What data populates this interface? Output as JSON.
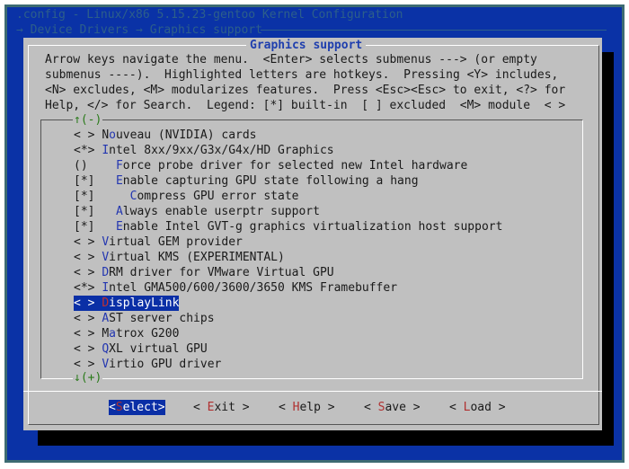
{
  "header": {
    "title": ".config - Linux/x86 5.15.23-gentoo Kernel Configuration",
    "breadcrumb": "→ Device Drivers → Graphics support"
  },
  "dialog": {
    "title": "Graphics support",
    "help_lines": [
      "Arrow keys navigate the menu.  <Enter> selects submenus ---> (or empty",
      "submenus ----).  Highlighted letters are hotkeys.  Pressing <Y> includes,",
      "<N> excludes, <M> modularizes features.  Press <Esc><Esc> to exit, <?> for",
      "Help, </> for Search.  Legend: [*] built-in  [ ] excluded  <M> module  < >"
    ],
    "scroll_up": "↑(-)",
    "scroll_down": "↓(+)",
    "items": [
      {
        "prefix": "< > ",
        "pre": "N",
        "key": "o",
        "post": "uveau (NVIDIA) cards"
      },
      {
        "prefix": "<*> ",
        "pre": "",
        "key": "I",
        "post": "ntel 8xx/9xx/G3x/G4x/HD Graphics"
      },
      {
        "prefix": "()    ",
        "pre": "",
        "key": "F",
        "post": "orce probe driver for selected new Intel hardware"
      },
      {
        "prefix": "[*]   ",
        "pre": "",
        "key": "E",
        "post": "nable capturing GPU state following a hang"
      },
      {
        "prefix": "[*]     ",
        "pre": "",
        "key": "C",
        "post": "ompress GPU error state"
      },
      {
        "prefix": "[*]   ",
        "pre": "",
        "key": "A",
        "post": "lways enable userptr support"
      },
      {
        "prefix": "[*]   ",
        "pre": "",
        "key": "E",
        "post": "nable Intel GVT-g graphics virtualization host support"
      },
      {
        "prefix": "< > ",
        "pre": "",
        "key": "V",
        "post": "irtual GEM provider"
      },
      {
        "prefix": "< > ",
        "pre": "",
        "key": "V",
        "post": "irtual KMS (EXPERIMENTAL)"
      },
      {
        "prefix": "< > ",
        "pre": "",
        "key": "D",
        "post": "RM driver for VMware Virtual GPU"
      },
      {
        "prefix": "<*> ",
        "pre": "",
        "key": "I",
        "post": "ntel GMA500/600/3600/3650 KMS Framebuffer"
      },
      {
        "prefix": "< > ",
        "pre": "",
        "key": "D",
        "post": "isplayLink",
        "selected": true
      },
      {
        "prefix": "< > ",
        "pre": "",
        "key": "A",
        "post": "ST server chips"
      },
      {
        "prefix": "< > ",
        "pre": "M",
        "key": "a",
        "post": "trox G200"
      },
      {
        "prefix": "< > ",
        "pre": "",
        "key": "Q",
        "post": "XL virtual GPU"
      },
      {
        "prefix": "< > ",
        "pre": "",
        "key": "V",
        "post": "irtio GPU driver"
      }
    ],
    "buttons": [
      {
        "l": "<",
        "key": "S",
        "post": "elect",
        "r": ">",
        "selected": true
      },
      {
        "l": "< ",
        "key": "E",
        "post": "xit",
        "r": " >"
      },
      {
        "l": "< ",
        "key": "H",
        "post": "elp",
        "r": " >"
      },
      {
        "l": "< ",
        "key": "S",
        "post": "ave",
        "r": " >"
      },
      {
        "l": "< ",
        "key": "L",
        "post": "oad",
        "r": " >"
      }
    ]
  }
}
